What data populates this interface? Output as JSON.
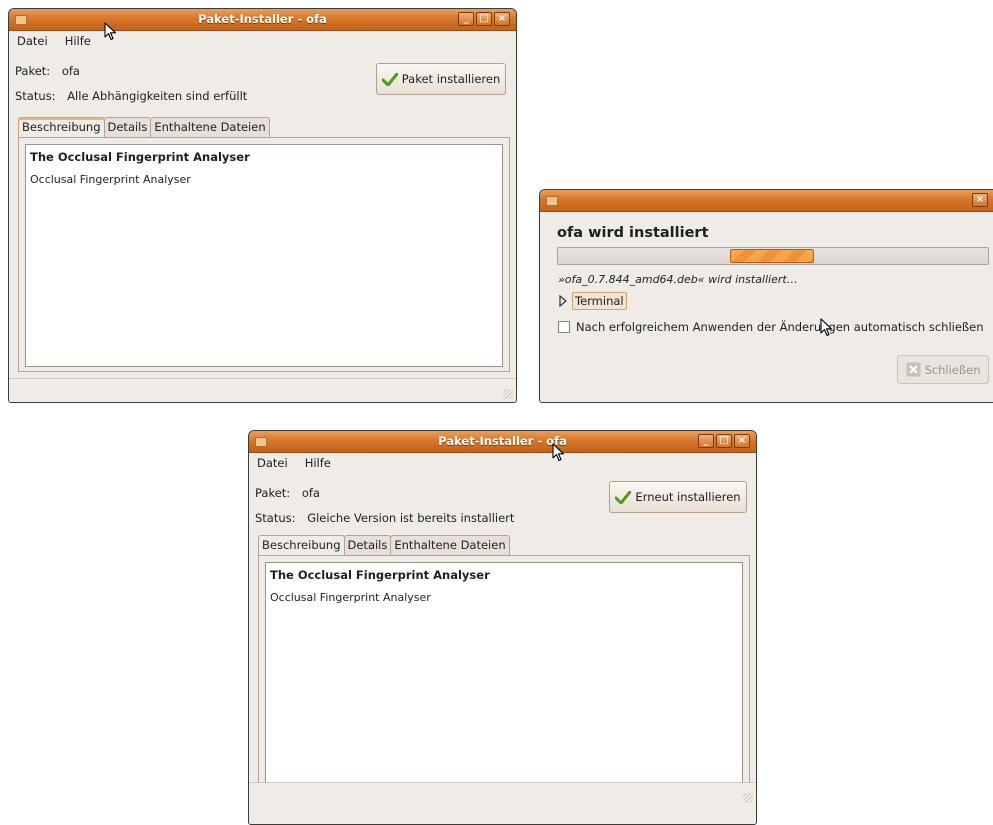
{
  "window1": {
    "title": "Paket-Installer - ofa",
    "menu": {
      "file": "Datei",
      "help": "Hilfe"
    },
    "package_label": "Paket:",
    "package_value": "ofa",
    "status_label": "Status:",
    "status_value": "Alle Abhängigkeiten sind erfüllt",
    "install_button": "Paket installieren",
    "tabs": [
      "Beschreibung",
      "Details",
      "Enthaltene Dateien"
    ],
    "desc_title": "The Occlusal Fingerprint Analyser",
    "desc_text": "Occlusal Fingerprint Analyser"
  },
  "dialog": {
    "heading": "ofa wird installiert",
    "progress_fraction": 0.195,
    "status_text": "»ofa_0.7.844_amd64.deb« wird installiert…",
    "terminal_label": "Terminal",
    "autoclose_label": "Nach erfolgreichem Anwenden der Änderungen automatisch schließen",
    "close_button": "Schließen"
  },
  "window2": {
    "title": "Paket-Installer - ofa",
    "menu": {
      "file": "Datei",
      "help": "Hilfe"
    },
    "package_label": "Paket:",
    "package_value": "ofa",
    "status_label": "Status:",
    "status_value": "Gleiche Version ist bereits installiert",
    "reinstall_button": "Erneut installieren",
    "tabs": [
      "Beschreibung",
      "Details",
      "Enthaltene Dateien"
    ],
    "desc_title": "The Occlusal Fingerprint Analyser",
    "desc_text": "Occlusal Fingerprint Analyser"
  },
  "colors": {
    "titlebar": "#d6772c",
    "window_bg": "#efebe7",
    "progress": "#f6a54e"
  },
  "icons": {
    "check": "check-icon",
    "close": "close-icon",
    "expander": "triangle-right-icon"
  }
}
